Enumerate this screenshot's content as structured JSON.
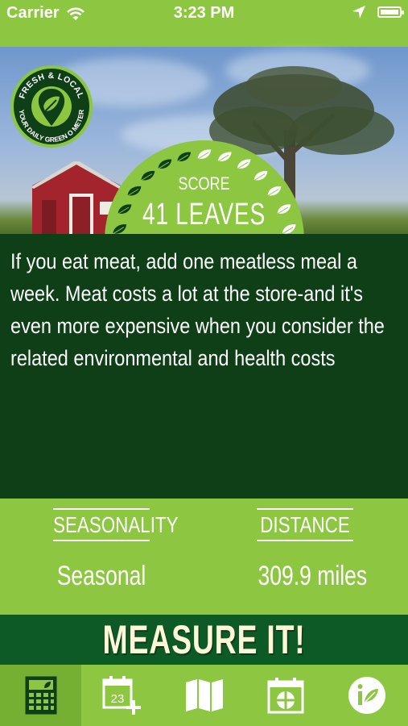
{
  "status_bar": {
    "carrier": "Carrier",
    "time": "3:23 PM",
    "icons": [
      "wifi-icon",
      "location-arrow-icon",
      "battery-icon"
    ]
  },
  "logo": {
    "text_top": "FRESH & LOCAL",
    "text_bottom": "YOUR DAILY GREEN O METER",
    "icon": "leaf-pin-icon"
  },
  "score": {
    "label": "SCORE",
    "value": "41 LEAVES",
    "leaf_count": 13
  },
  "tip": {
    "text": "If you eat meat, add one meatless meal a week. Meat costs a lot at the store-and it's even more expensive when you consider the related environmental and health costs"
  },
  "metrics": [
    {
      "title": "SEASONALITY",
      "value": "Seasonal"
    },
    {
      "title": "DISTANCE",
      "value": "309.9 miles"
    }
  ],
  "measure_button": {
    "label": "MEASURE IT!"
  },
  "tabs": [
    {
      "icon": "calculator-icon",
      "active": true
    },
    {
      "icon": "calendar-add-icon",
      "badge": "23",
      "active": false
    },
    {
      "icon": "map-icon",
      "active": false
    },
    {
      "icon": "calendar-grid-icon",
      "active": false
    },
    {
      "icon": "info-leaf-icon",
      "active": false
    }
  ],
  "colors": {
    "light_green": "#8dc640",
    "dark_green": "#0e3f16",
    "button_green": "#0e5a27",
    "button_text": "#fbf7d8"
  }
}
